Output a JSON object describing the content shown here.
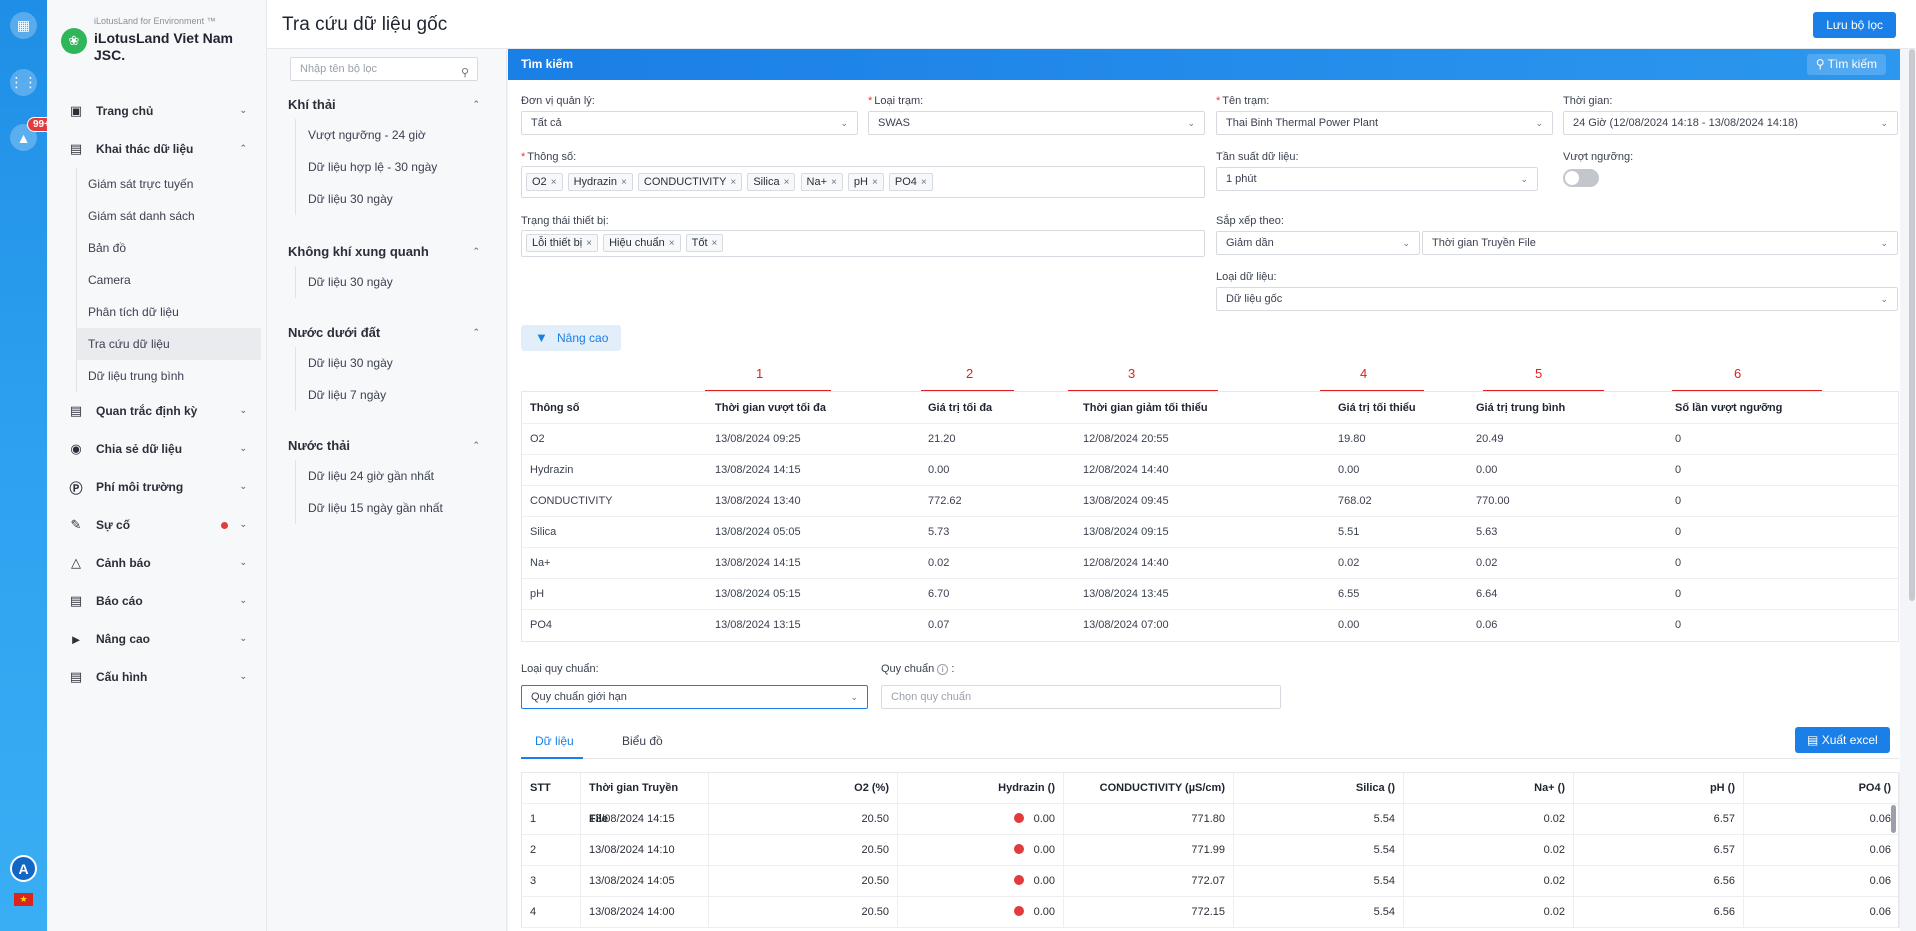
{
  "rail": {
    "badge": "99+",
    "avatar": "A"
  },
  "brand": {
    "sub": "iLotusLand for Environment ™",
    "name": "iLotusLand Viet Nam JSC."
  },
  "header": {
    "title": "Tra cứu dữ liệu gốc",
    "save_label": "Lưu bộ lọc"
  },
  "sidebar": {
    "items": [
      {
        "label": "Trang chủ",
        "icon": "home-icon"
      },
      {
        "label": "Khai thác dữ liệu",
        "icon": "data-mining-icon"
      },
      {
        "label": "Quan trắc định kỳ",
        "icon": "periodic-icon"
      },
      {
        "label": "Chia sẻ dữ liệu",
        "icon": "share-icon"
      },
      {
        "label": "Phí môi trường",
        "icon": "fee-icon"
      },
      {
        "label": "Sự cố",
        "icon": "incident-icon"
      },
      {
        "label": "Cảnh báo",
        "icon": "alarm-icon"
      },
      {
        "label": "Báo cáo",
        "icon": "report-icon"
      },
      {
        "label": "Nâng cao",
        "icon": "megaphone-icon"
      },
      {
        "label": "Cấu hình",
        "icon": "config-icon"
      }
    ],
    "sub_items": [
      "Giám sát trực tuyến",
      "Giám sát danh sách",
      "Bản đồ",
      "Camera",
      "Phân tích dữ liệu",
      "Tra cứu dữ liệu",
      "Dữ liệu trung bình"
    ]
  },
  "filters": {
    "search_placeholder": "Nhập tên bộ lọc",
    "groups": [
      {
        "title": "Khí thải",
        "items": [
          "Vượt ngưỡng - 24 giờ",
          "Dữ liệu hợp lệ - 30 ngày",
          "Dữ liệu 30 ngày"
        ]
      },
      {
        "title": "Không khí xung quanh",
        "items": [
          "Dữ liệu 30 ngày"
        ]
      },
      {
        "title": "Nước dưới đất",
        "items": [
          "Dữ liệu 30 ngày",
          "Dữ liệu 7 ngày"
        ]
      },
      {
        "title": "Nước thải",
        "items": [
          "Dữ liệu 24 giờ gần nhất",
          "Dữ liệu 15 ngày gần nhất"
        ]
      }
    ]
  },
  "search": {
    "bar_label": "Tìm kiếm",
    "button_label": "Tìm kiếm",
    "unit_label": "Đơn vị quản lý:",
    "unit_value": "Tất cả",
    "station_type_label": "Loại trạm:",
    "station_type_value": "SWAS",
    "station_label": "Tên trạm:",
    "station_value": "Thai Binh Thermal Power Plant",
    "time_label": "Thời gian:",
    "time_value": "24 Giờ (12/08/2024 14:18 - 13/08/2024 14:18)",
    "params_label": "Thông số:",
    "params": [
      "O2",
      "Hydrazin",
      "CONDUCTIVITY",
      "Silica",
      "Na+",
      "pH",
      "PO4"
    ],
    "freq_label": "Tần suất dữ liệu:",
    "freq_value": "1 phút",
    "exceed_label": "Vượt ngưỡng:",
    "device_label": "Trạng thái thiết bị:",
    "device_status": [
      "Lỗi thiết bị",
      "Hiệu chuẩn",
      "Tốt"
    ],
    "sort_label": "Sắp xếp theo:",
    "sort_order": "Giảm dần",
    "sort_field": "Thời gian Truyền File",
    "datatype_label": "Loại dữ liệu:",
    "datatype_value": "Dữ liệu gốc",
    "advanced_label": "Nâng cao"
  },
  "summary": {
    "markers": [
      "1",
      "2",
      "3",
      "4",
      "5",
      "6"
    ],
    "headers": [
      "Thông số",
      "Thời gian vượt tối đa",
      "Giá trị tối đa",
      "Thời gian giảm tối thiểu",
      "Giá trị tối thiểu",
      "Giá trị trung bình",
      "Số lần vượt ngưỡng"
    ],
    "rows": [
      [
        "O2",
        "13/08/2024 09:25",
        "21.20",
        "12/08/2024 20:55",
        "19.80",
        "20.49",
        "0"
      ],
      [
        "Hydrazin",
        "13/08/2024 14:15",
        "0.00",
        "12/08/2024 14:40",
        "0.00",
        "0.00",
        "0"
      ],
      [
        "CONDUCTIVITY",
        "13/08/2024 13:40",
        "772.62",
        "13/08/2024 09:45",
        "768.02",
        "770.00",
        "0"
      ],
      [
        "Silica",
        "13/08/2024 05:05",
        "5.73",
        "13/08/2024 09:15",
        "5.51",
        "5.63",
        "0"
      ],
      [
        "Na+",
        "13/08/2024 14:15",
        "0.02",
        "12/08/2024 14:40",
        "0.02",
        "0.02",
        "0"
      ],
      [
        "pH",
        "13/08/2024 05:15",
        "6.70",
        "13/08/2024 13:45",
        "6.55",
        "6.64",
        "0"
      ],
      [
        "PO4",
        "13/08/2024 13:15",
        "0.07",
        "13/08/2024 07:00",
        "0.00",
        "0.06",
        "0"
      ]
    ]
  },
  "standard": {
    "type_label": "Loại quy chuẩn:",
    "type_value": "Quy chuẩn giới hạn",
    "label": "Quy chuẩn",
    "placeholder": "Chọn quy chuẩn"
  },
  "tabs": {
    "data": "Dữ liệu",
    "chart": "Biểu đồ",
    "export": "Xuất excel"
  },
  "data_table": {
    "headers": [
      "STT",
      "Thời gian Truyền File",
      "O2 (%)",
      "Hydrazin ()",
      "CONDUCTIVITY (µS/cm)",
      "Silica ()",
      "Na+ ()",
      "pH ()",
      "PO4 ()"
    ],
    "rows": [
      [
        "1",
        "13/08/2024 14:15",
        "20.50",
        "0.00",
        "771.80",
        "5.54",
        "0.02",
        "6.57",
        "0.06"
      ],
      [
        "2",
        "13/08/2024 14:10",
        "20.50",
        "0.00",
        "771.99",
        "5.54",
        "0.02",
        "6.57",
        "0.06"
      ],
      [
        "3",
        "13/08/2024 14:05",
        "20.50",
        "0.00",
        "772.07",
        "5.54",
        "0.02",
        "6.56",
        "0.06"
      ],
      [
        "4",
        "13/08/2024 14:00",
        "20.50",
        "0.00",
        "772.15",
        "5.54",
        "0.02",
        "6.56",
        "0.06"
      ]
    ]
  }
}
